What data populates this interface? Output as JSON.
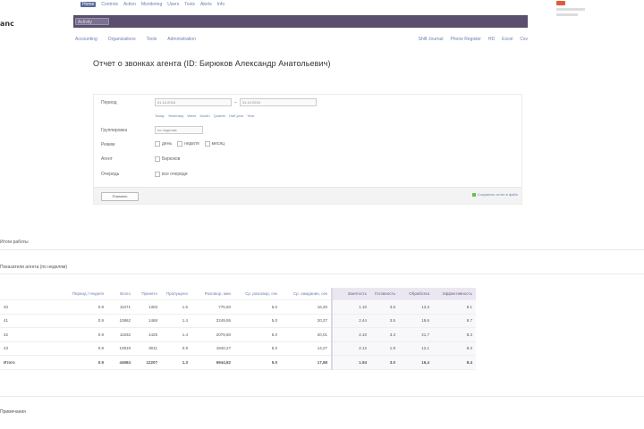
{
  "brand": "anc",
  "topnav": [
    "Home",
    "Controls",
    "Action",
    "Monitoring",
    "Users",
    "Tools",
    "Alerts",
    "Info"
  ],
  "titlebar_label": "Activity",
  "subnav_left": [
    "Accounting",
    "Organizations",
    "Tools",
    "Administration"
  ],
  "subnav_right": [
    "Shift Journal",
    "Phone Register",
    "HD",
    "Excel",
    "Csv"
  ],
  "report_title": "Отчет о звонках агента (ID: Бирюков Александр Анатольевич)",
  "form": {
    "period_label": "Период",
    "date_from": "01.10.2015",
    "date_to": "31.10.2015",
    "presets": [
      "Today",
      "Yesterday",
      "Week",
      "Month",
      "Quarter",
      "Half year",
      "Year"
    ],
    "group_label": "Группировка",
    "group_value": "по неделям",
    "mode_label": "Режим",
    "mode_options": [
      "день",
      "неделя",
      "месяц"
    ],
    "agent_label": "Агент",
    "agent_value": "Бирюков",
    "queue_label": "Очередь",
    "queue_value": "все очереди",
    "submit_label": "Показать",
    "save_link": "Сохранить отчет в файл"
  },
  "section1": "Итоги работы",
  "section2": "Показатели агента (по неделям)",
  "section3": "Примечания",
  "table": {
    "headers": [
      "",
      "Период / Неделя",
      "Всего",
      "Принято",
      "Пропущено",
      "Разговор, мин",
      "Ср. разговор, сек",
      "Ср. ожидание, сек",
      "Занятость",
      "Готовность",
      "Обработка",
      "Эффективность"
    ],
    "rows": [
      [
        "40",
        "0.9",
        "11071",
        "1303",
        "1.5",
        "775,50",
        "5.0",
        "16,20",
        "1.10",
        "3.5",
        "13,3",
        "8.1"
      ],
      [
        "41",
        "0.9",
        "10862",
        "1468",
        "1.4",
        "2249,55",
        "5.0",
        "20,27",
        "2.44",
        "3.5",
        "18,6",
        "8.7"
      ],
      [
        "42",
        "0.9",
        "11932",
        "1425",
        "1.4",
        "2079,50",
        "5.0",
        "20,01",
        "2.10",
        "3.3",
        "21,7",
        "8.3"
      ],
      [
        "43",
        "0.9",
        "10819",
        "8011",
        "0.9",
        "1840,27",
        "5.0",
        "14,27",
        "2.12",
        "1.9",
        "12,1",
        "8.3"
      ],
      [
        "Итого",
        "0.9",
        "44684",
        "12207",
        "1.3",
        "6944,82",
        "5.0",
        "17,68",
        "1.94",
        "3.0",
        "16,4",
        "8.4"
      ]
    ]
  }
}
